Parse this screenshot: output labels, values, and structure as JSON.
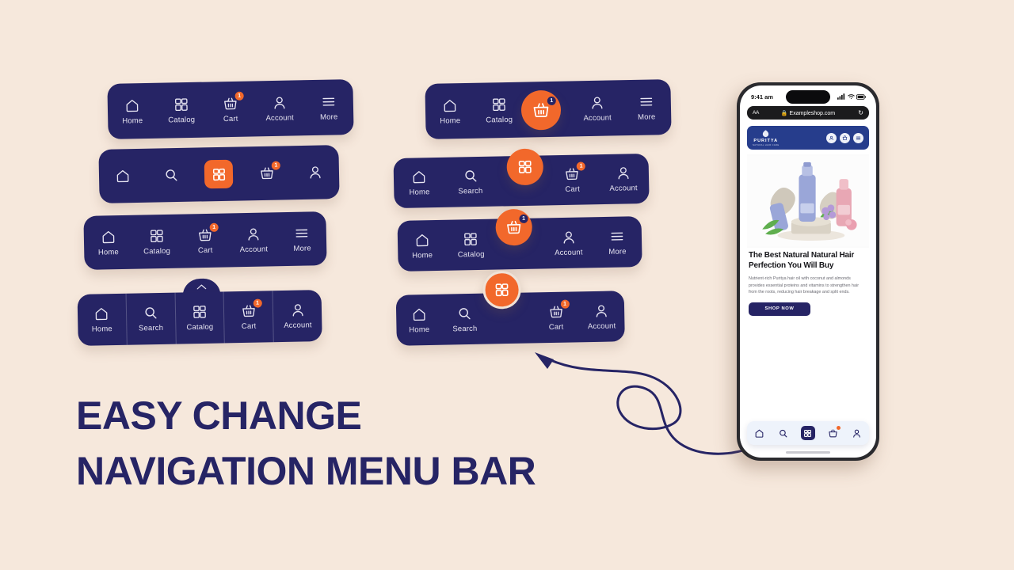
{
  "theme": {
    "background": "#f6e8dc",
    "navy": "#262465",
    "orange": "#f2682b",
    "label": "#e6e4f0"
  },
  "title": {
    "line1": "EASY CHANGE",
    "line2": "NAVIGATION MENU BAR"
  },
  "navbars": [
    {
      "id": "nav-1",
      "style": "labels-plain",
      "items": [
        {
          "icon": "home-icon",
          "label": "Home",
          "badge": null
        },
        {
          "icon": "catalog-grid-icon",
          "label": "Catalog",
          "badge": null
        },
        {
          "icon": "basket-icon",
          "label": "Cart",
          "badge": "1"
        },
        {
          "icon": "account-icon",
          "label": "Account",
          "badge": null
        },
        {
          "icon": "more-menu-icon",
          "label": "More",
          "badge": null
        }
      ]
    },
    {
      "id": "nav-2",
      "style": "icons-only-active-square",
      "items": [
        {
          "icon": "home-icon",
          "label": "",
          "badge": null
        },
        {
          "icon": "search-icon",
          "label": "",
          "badge": null
        },
        {
          "icon": "catalog-grid-icon",
          "label": "",
          "badge": null,
          "active": true
        },
        {
          "icon": "basket-icon",
          "label": "",
          "badge": "1"
        },
        {
          "icon": "account-icon",
          "label": "",
          "badge": null
        }
      ]
    },
    {
      "id": "nav-3",
      "style": "labels-plain",
      "items": [
        {
          "icon": "home-icon",
          "label": "Home",
          "badge": null
        },
        {
          "icon": "catalog-grid-icon",
          "label": "Catalog",
          "badge": null
        },
        {
          "icon": "basket-icon",
          "label": "Cart",
          "badge": "1"
        },
        {
          "icon": "account-icon",
          "label": "Account",
          "badge": null
        },
        {
          "icon": "more-menu-icon",
          "label": "More",
          "badge": null
        }
      ]
    },
    {
      "id": "nav-4",
      "style": "divided-with-bump",
      "bump_icon": "chevron-up-icon",
      "items": [
        {
          "icon": "home-icon",
          "label": "Home",
          "badge": null
        },
        {
          "icon": "search-icon",
          "label": "Search",
          "badge": null
        },
        {
          "icon": "catalog-grid-icon",
          "label": "Catalog",
          "badge": null
        },
        {
          "icon": "basket-icon",
          "label": "Cart",
          "badge": "1"
        },
        {
          "icon": "account-icon",
          "label": "Account",
          "badge": null
        }
      ]
    },
    {
      "id": "nav-5",
      "style": "center-fab-inline",
      "fab": {
        "icon": "basket-icon",
        "badge": "1"
      },
      "items": [
        {
          "icon": "home-icon",
          "label": "Home",
          "badge": null
        },
        {
          "icon": "catalog-grid-icon",
          "label": "Catalog",
          "badge": null
        },
        {
          "icon": "account-icon",
          "label": "Account",
          "badge": null
        },
        {
          "icon": "more-menu-icon",
          "label": "More",
          "badge": null
        }
      ]
    },
    {
      "id": "nav-6",
      "style": "center-fab-overlap-small",
      "fab": {
        "icon": "catalog-grid-icon",
        "badge": null
      },
      "items": [
        {
          "icon": "home-icon",
          "label": "Home",
          "badge": null
        },
        {
          "icon": "search-icon",
          "label": "Search",
          "badge": null
        },
        {
          "icon": "basket-icon",
          "label": "Cart",
          "badge": "1"
        },
        {
          "icon": "account-icon",
          "label": "Account",
          "badge": null
        }
      ]
    },
    {
      "id": "nav-7",
      "style": "center-fab-raised",
      "fab": {
        "icon": "basket-icon",
        "badge": "1"
      },
      "items": [
        {
          "icon": "home-icon",
          "label": "Home",
          "badge": null
        },
        {
          "icon": "catalog-grid-icon",
          "label": "Catalog",
          "badge": null
        },
        {
          "icon": "account-icon",
          "label": "Account",
          "badge": null
        },
        {
          "icon": "more-menu-icon",
          "label": "More",
          "badge": null
        }
      ]
    },
    {
      "id": "nav-8",
      "style": "center-fab-floating",
      "fab": {
        "icon": "catalog-grid-icon",
        "badge": null
      },
      "items": [
        {
          "icon": "home-icon",
          "label": "Home",
          "badge": null
        },
        {
          "icon": "search-icon",
          "label": "Search",
          "badge": null
        },
        {
          "icon": "basket-icon",
          "label": "Cart",
          "badge": "1"
        },
        {
          "icon": "account-icon",
          "label": "Account",
          "badge": null
        }
      ]
    }
  ],
  "phone": {
    "status": {
      "time": "9:41 am"
    },
    "browser": {
      "aa": "AA",
      "url": "Exampleshop.com",
      "reload": "↻"
    },
    "site": {
      "brand_name": "PURITYA",
      "brand_sub": "NATURAL HAIR CARE",
      "header_buttons": [
        "user-icon",
        "cart-icon",
        "menu-icon"
      ],
      "headline": "The Best Natural Natural Hair Perfection You Will Buy",
      "body": "Nutrient-rich Puritya hair oil with coconut and almonds provides essential proteins and vitamins to strengthen hair from the roots, reducing hair breakage and split ends.",
      "cta": "SHOP NOW"
    },
    "bottom_nav": [
      {
        "icon": "home-icon",
        "active": false,
        "badge": false
      },
      {
        "icon": "search-icon",
        "active": false,
        "badge": false
      },
      {
        "icon": "catalog-grid-icon",
        "active": true,
        "badge": false
      },
      {
        "icon": "basket-icon",
        "active": false,
        "badge": true
      },
      {
        "icon": "account-icon",
        "active": false,
        "badge": false
      }
    ]
  }
}
